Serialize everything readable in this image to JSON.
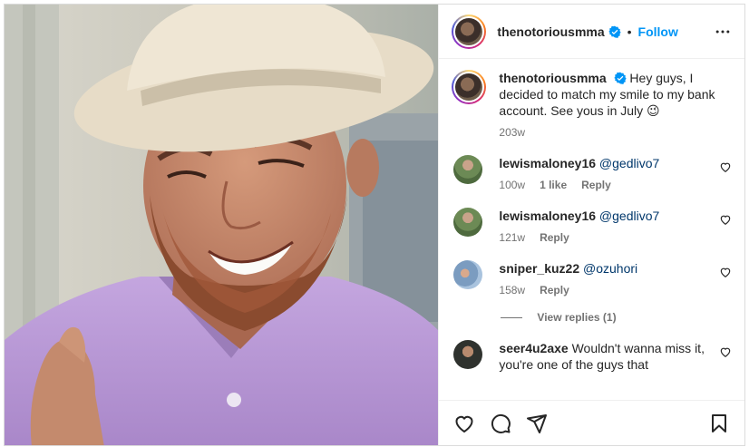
{
  "post": {
    "username": "thenotoriousmma",
    "follow_label": "Follow",
    "separator": "•",
    "caption_username": "thenotoriousmma",
    "caption_text": "Hey guys, I decided to match my smile to my bank account. See yous in July 😉",
    "caption_time": "203w"
  },
  "comments": [
    {
      "username": "lewismaloney16",
      "mention": "@gedlivo7",
      "text": "",
      "time": "100w",
      "likes": "1 like",
      "reply_label": "Reply",
      "avatar_color": "#8fa77f"
    },
    {
      "username": "lewismaloney16",
      "mention": "@gedlivo7",
      "text": "",
      "time": "121w",
      "likes": "",
      "reply_label": "Reply",
      "avatar_color": "#8fa77f"
    },
    {
      "username": "sniper_kuz22",
      "mention": "@ozuhori",
      "text": "",
      "time": "158w",
      "likes": "",
      "reply_label": "Reply",
      "avatar_color": "#7a98b8"
    },
    {
      "username": "seer4u2axe",
      "mention": "",
      "text": "Wouldn't wanna miss it, you're one of the guys that",
      "time": "",
      "likes": "",
      "reply_label": "",
      "avatar_color": "#3c3f3a"
    }
  ],
  "view_replies": "View replies (1)",
  "icons": {
    "verified": "verified-badge-icon",
    "more": "more-options-icon",
    "like": "heart-icon",
    "comment": "comment-icon",
    "share": "share-icon",
    "save": "bookmark-icon"
  },
  "colors": {
    "follow": "#0095f6",
    "verified": "#0095f6",
    "shirt": "#b99ad6"
  }
}
